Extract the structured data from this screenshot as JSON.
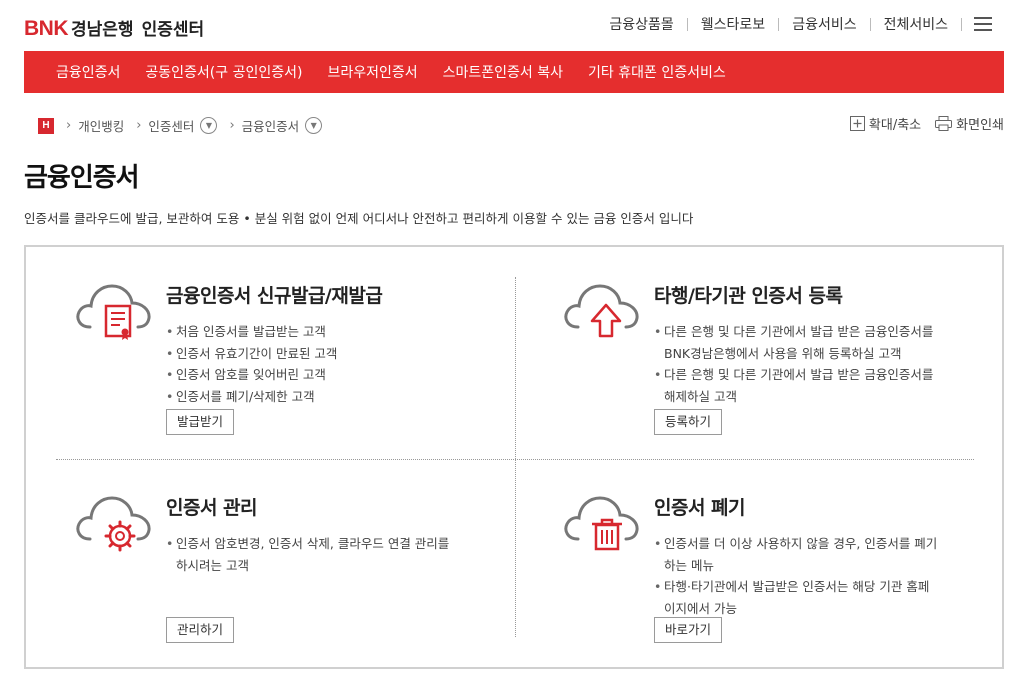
{
  "header": {
    "logo_brand": "BNK",
    "logo_bank": "경남은행",
    "logo_center": "인증센터",
    "util_links": [
      "금융상품몰",
      "웰스타로보",
      "금융서비스",
      "전체서비스"
    ]
  },
  "gnb": [
    "금융인증서",
    "공동인증서(구 공인인증서)",
    "브라우저인증서",
    "스마트폰인증서 복사",
    "기타 휴대폰 인증서비스"
  ],
  "breadcrumb": {
    "home_letter": "H",
    "items": [
      "개인뱅킹",
      "인증센터",
      "금융인증서"
    ]
  },
  "tools": {
    "zoom": "확대/축소",
    "print": "화면인쇄"
  },
  "page": {
    "title": "금융인증서",
    "description": "인증서를 클라우드에 발급, 보관하여 도용 • 분실 위험 없이 언제 어디서나 안전하고 편리하게 이용할 수 있는 금융 인증서 입니다"
  },
  "cards": [
    {
      "title": "금융인증서 신규발급/재발급",
      "icon": "cloud-certificate-icon",
      "items": [
        "처음 인증서를 발급받는 고객",
        "인증서 유효기간이 만료된 고객",
        "인증서 암호를 잊어버린 고객",
        "인증서를 폐기/삭제한 고객"
      ],
      "button": "발급받기"
    },
    {
      "title": "타행/타기관 인증서 등록",
      "icon": "cloud-upload-icon",
      "items": [
        "다른 은행 및 다른 기관에서 발급 받은 금융인증서를",
        "BNK경남은행에서 사용을 위해 등록하실 고객",
        "다른 은행 및 다른 기관에서 발급 받은 금융인증서를",
        "해제하실 고객"
      ],
      "button": "등록하기"
    },
    {
      "title": "인증서 관리",
      "icon": "cloud-gear-icon",
      "items": [
        "인증서 암호변경, 인증서 삭제, 클라우드 연결 관리를",
        "하시려는 고객"
      ],
      "button": "관리하기"
    },
    {
      "title": "인증서 폐기",
      "icon": "cloud-trash-icon",
      "items": [
        "인증서를 더 이상 사용하지 않을 경우, 인증서를 폐기",
        "하는 메뉴",
        "타행·타기관에서 발급받은 인증서는 해당 기관 홈페",
        "이지에서 가능"
      ],
      "button": "바로가기"
    }
  ],
  "colors": {
    "accent": "#e52e2e",
    "brand": "#d7282f",
    "icon_gray": "#777777"
  }
}
